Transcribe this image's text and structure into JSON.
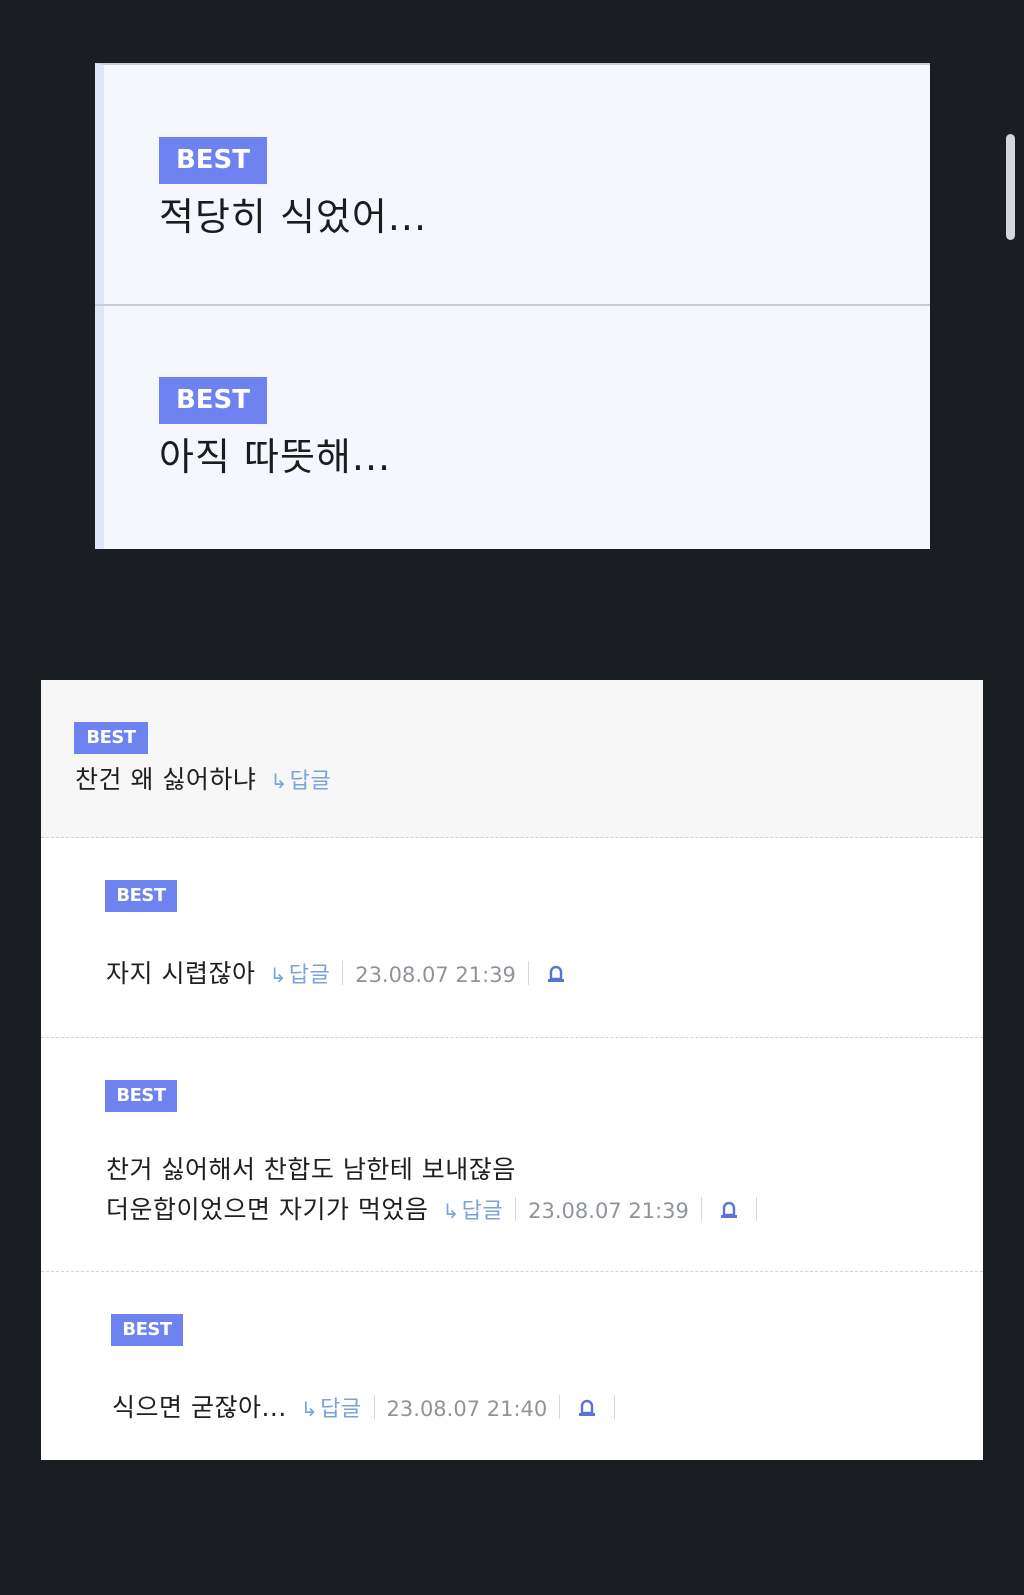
{
  "top_panel": {
    "items": [
      {
        "badge": "BEST",
        "text": "적당히 식었어..."
      },
      {
        "badge": "BEST",
        "text": "아직 따뜻해..."
      }
    ]
  },
  "bottom_panel": {
    "comments": [
      {
        "badge": "BEST",
        "text": "찬건 왜 싫어하냐",
        "reply_label": "답글"
      },
      {
        "badge": "BEST",
        "text": "자지 시렵잖아",
        "reply_label": "답글",
        "timestamp": "23.08.07 21:39"
      },
      {
        "badge": "BEST",
        "text_line1": "찬거 싫어해서 찬합도 남한테 보내잖음",
        "text_line2": "더운합이었으면 자기가 먹었음",
        "reply_label": "답글",
        "timestamp": "23.08.07 21:39"
      },
      {
        "badge": "BEST",
        "text": "식으면 굳잖아...",
        "reply_label": "답글",
        "timestamp": "23.08.07 21:40"
      }
    ]
  },
  "icons": {
    "reply": "reply-arrow-icon",
    "report": "bell-icon"
  },
  "colors": {
    "background": "#1a1d22",
    "badge": "#6e82f0",
    "reply_link": "#7aa2dd",
    "timestamp": "#8f949b"
  }
}
